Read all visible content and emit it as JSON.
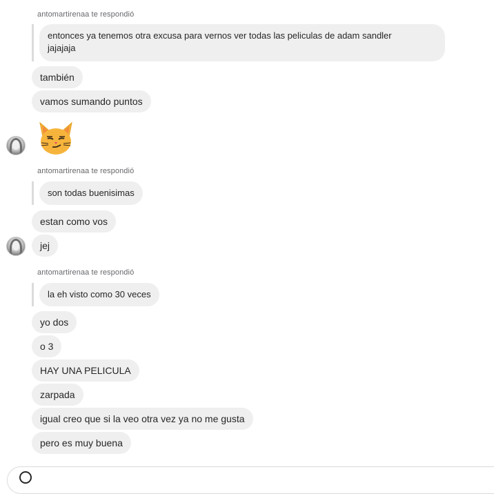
{
  "messages": {
    "reply_label_1": "antomartirenaa te respondió",
    "quoted_1": "entonces ya tenemos otra excusa para vernos ver todas las peliculas de adam sandler\njajajaja",
    "msg_tambien": "también",
    "msg_sumando": "vamos sumando puntos",
    "emoji_name": "smirking-cat-emoji",
    "reply_label_2": "antomartirenaa te respondió",
    "quoted_2": "son todas buenisimas",
    "msg_estan": "estan como vos",
    "msg_jej": "jej",
    "reply_label_3": "antomartirenaa te respondió",
    "quoted_3": "la eh visto como 30 veces",
    "msg_yo_dos": "yo dos",
    "msg_o3": "o 3",
    "msg_hay": "HAY UNA PELICULA",
    "msg_zarpada": "zarpada",
    "msg_igual": "igual creo que si la veo otra vez ya no me gusta",
    "msg_pero": "pero es muy buena"
  },
  "icons": {
    "avatar": "contact-avatar",
    "input_emoji": "emoji-icon"
  },
  "colors": {
    "bubble": "#efefef",
    "text": "#262626",
    "label": "#65676b",
    "reply_bar": "#dbdbdb",
    "cat_face": "#f7b43c"
  }
}
